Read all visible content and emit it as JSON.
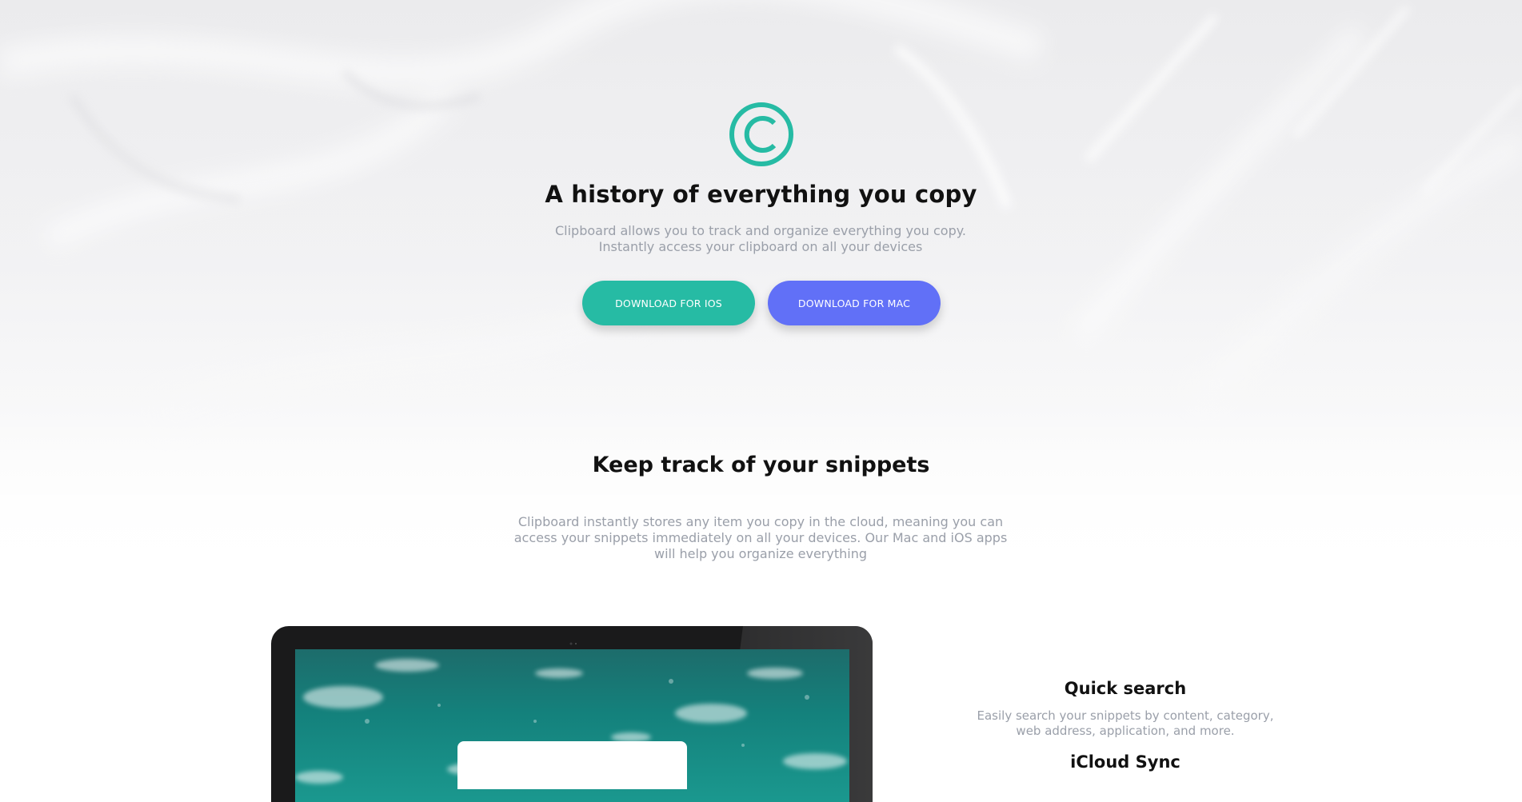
{
  "hero": {
    "title": "A history of everything you copy",
    "subtitle": "Clipboard allows you to track and organize everything you copy. Instantly access your clipboard on all your devices",
    "logo_icon": "copyright-icon",
    "buttons": {
      "ios_label": "Download for iOS",
      "mac_label": "Download for Mac"
    }
  },
  "snippets": {
    "title": "Keep track of your snippets",
    "description": "Clipboard instantly stores any item you copy in the cloud, meaning you can access your snippets immediately on all your devices. Our Mac and iOS apps will help you organize everything"
  },
  "features": [
    {
      "title": "Quick search",
      "description": "Easily search your snippets by content, category, web address, application, and more."
    },
    {
      "title": "iCloud Sync",
      "description": ""
    }
  ],
  "colors": {
    "primary_teal": "#26bba4",
    "accent_blue": "#6170f7",
    "text_gray": "#9a9fa9",
    "heading": "#111111"
  }
}
